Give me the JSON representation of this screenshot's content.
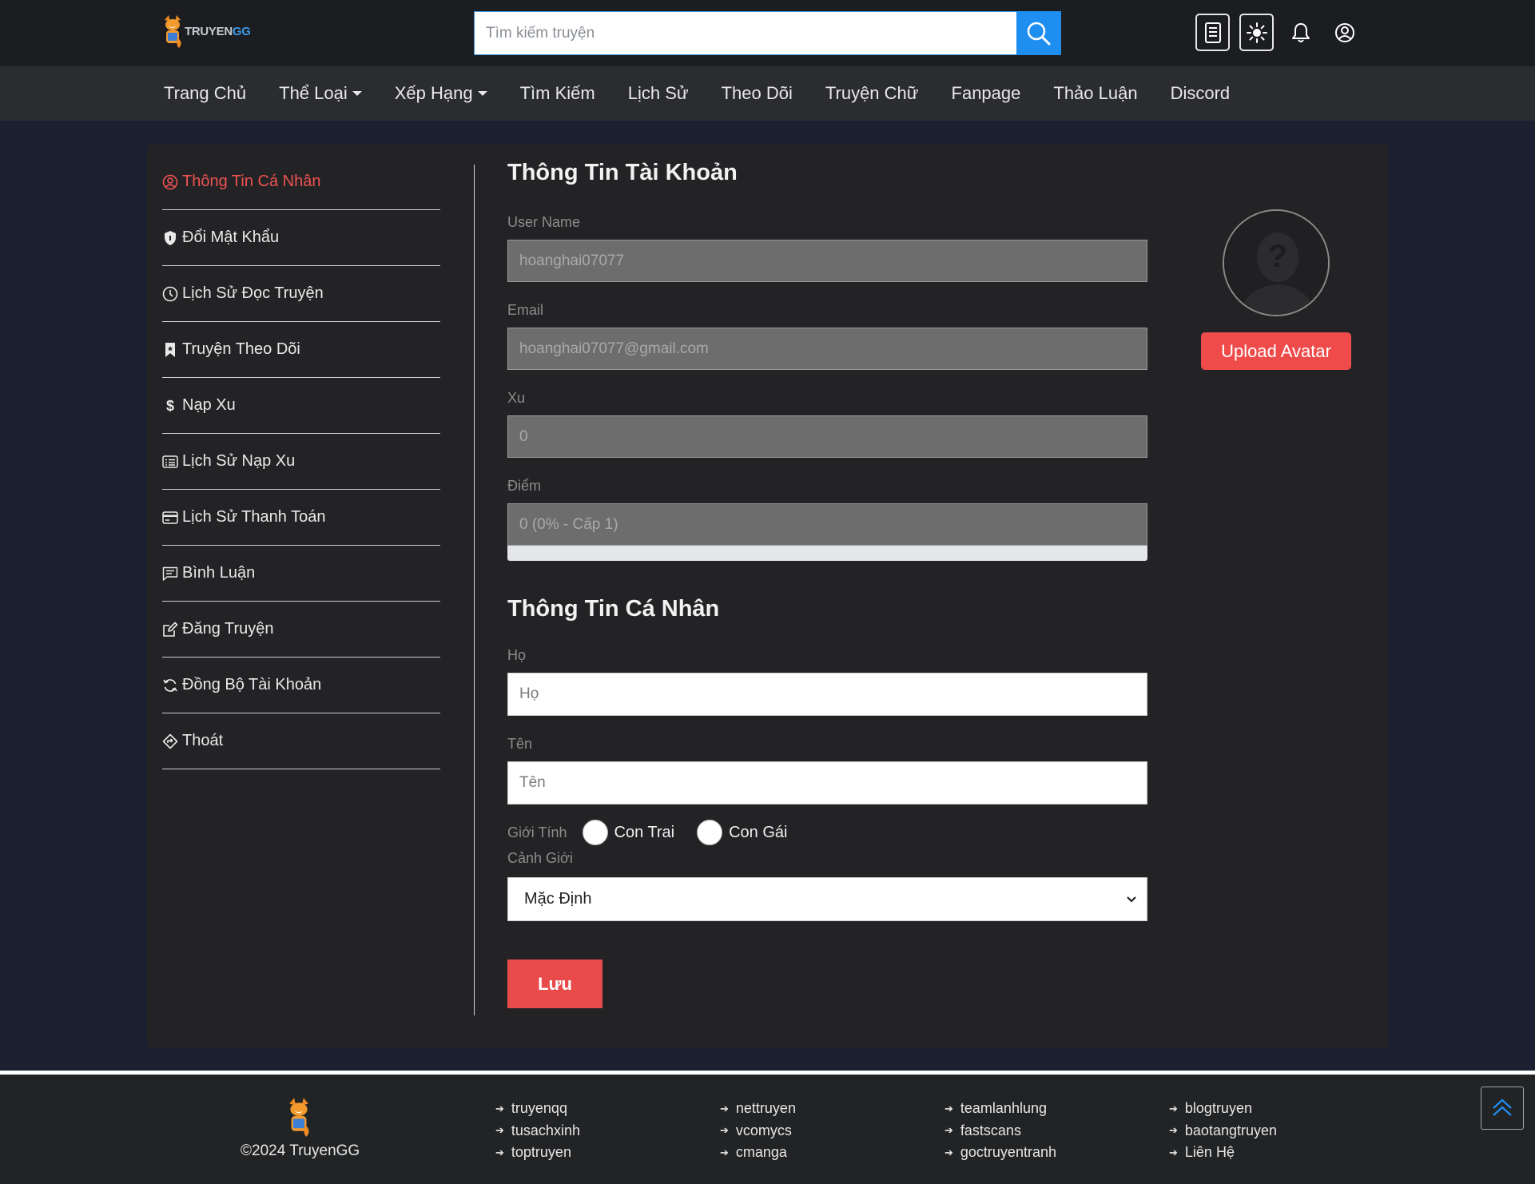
{
  "header": {
    "logo_text_a": "TRUYEN",
    "logo_text_b": "GG",
    "search_placeholder": "Tìm kiếm truyện",
    "icons": [
      "list-icon",
      "sun-icon",
      "bell-icon",
      "user-circle-icon"
    ]
  },
  "nav": {
    "items": [
      {
        "label": "Trang Chủ",
        "dropdown": false
      },
      {
        "label": "Thể Loại",
        "dropdown": true
      },
      {
        "label": "Xếp Hạng",
        "dropdown": true
      },
      {
        "label": "Tìm Kiếm",
        "dropdown": false
      },
      {
        "label": "Lịch Sử",
        "dropdown": false
      },
      {
        "label": "Theo Dõi",
        "dropdown": false
      },
      {
        "label": "Truyện Chữ",
        "dropdown": false
      },
      {
        "label": "Fanpage",
        "dropdown": false
      },
      {
        "label": "Thảo Luận",
        "dropdown": false
      },
      {
        "label": "Discord",
        "dropdown": false
      }
    ]
  },
  "sidebar": {
    "items": [
      {
        "label": "Thông Tin Cá Nhân",
        "icon": "user-circle-icon"
      },
      {
        "label": "Đổi Mật Khẩu",
        "icon": "shield-icon"
      },
      {
        "label": "Lịch Sử Đọc Truyện",
        "icon": "clock-icon"
      },
      {
        "label": "Truyện Theo Dõi",
        "icon": "bookmark-icon"
      },
      {
        "label": "Nạp Xu",
        "icon": "dollar-icon"
      },
      {
        "label": "Lịch Sử Nạp Xu",
        "icon": "list-card-icon"
      },
      {
        "label": "Lịch Sử Thanh Toán",
        "icon": "credit-card-icon"
      },
      {
        "label": "Bình Luận",
        "icon": "comment-icon"
      },
      {
        "label": "Đăng Truyện",
        "icon": "edit-icon"
      },
      {
        "label": "Đồng Bộ Tài Khoản",
        "icon": "sync-icon"
      },
      {
        "label": "Thoát",
        "icon": "signout-icon"
      }
    ],
    "active_color": "#ef5350"
  },
  "account": {
    "title": "Thông Tin Tài Khoản",
    "username_label": "User Name",
    "username_value": "hoanghai07077",
    "email_label": "Email",
    "email_value": "hoanghai07077@gmail.com",
    "xu_label": "Xu",
    "xu_value": "0",
    "diem_label": "Điểm",
    "diem_value": "0 (0% - Cấp 1)",
    "level_progress": 0
  },
  "avatar": {
    "upload_label": "Upload Avatar"
  },
  "personal": {
    "title": "Thông Tin Cá Nhân",
    "ho_label": "Họ",
    "ho_placeholder": "Họ",
    "ten_label": "Tên",
    "ten_placeholder": "Tên",
    "gender_label": "Giới Tính",
    "gender_male": "Con Trai",
    "gender_female": "Con Gái",
    "canh_gioi_label": "Cảnh Giới",
    "canh_gioi_value": "Mặc Định",
    "save_label": "Lưu"
  },
  "footer": {
    "copyright": "©2024 TruyenGG",
    "columns": [
      [
        "truyenqq",
        "tusachxinh",
        "toptruyen"
      ],
      [
        "nettruyen",
        "vcomycs",
        "cmanga"
      ],
      [
        "teamlanhlung",
        "fastscans",
        "goctruyentranh"
      ],
      [
        "blogtruyen",
        "baotangtruyen",
        "Liên Hệ"
      ]
    ]
  },
  "colors": {
    "accent_blue": "#1f8ef1",
    "accent_red": "#ef4b4b"
  }
}
